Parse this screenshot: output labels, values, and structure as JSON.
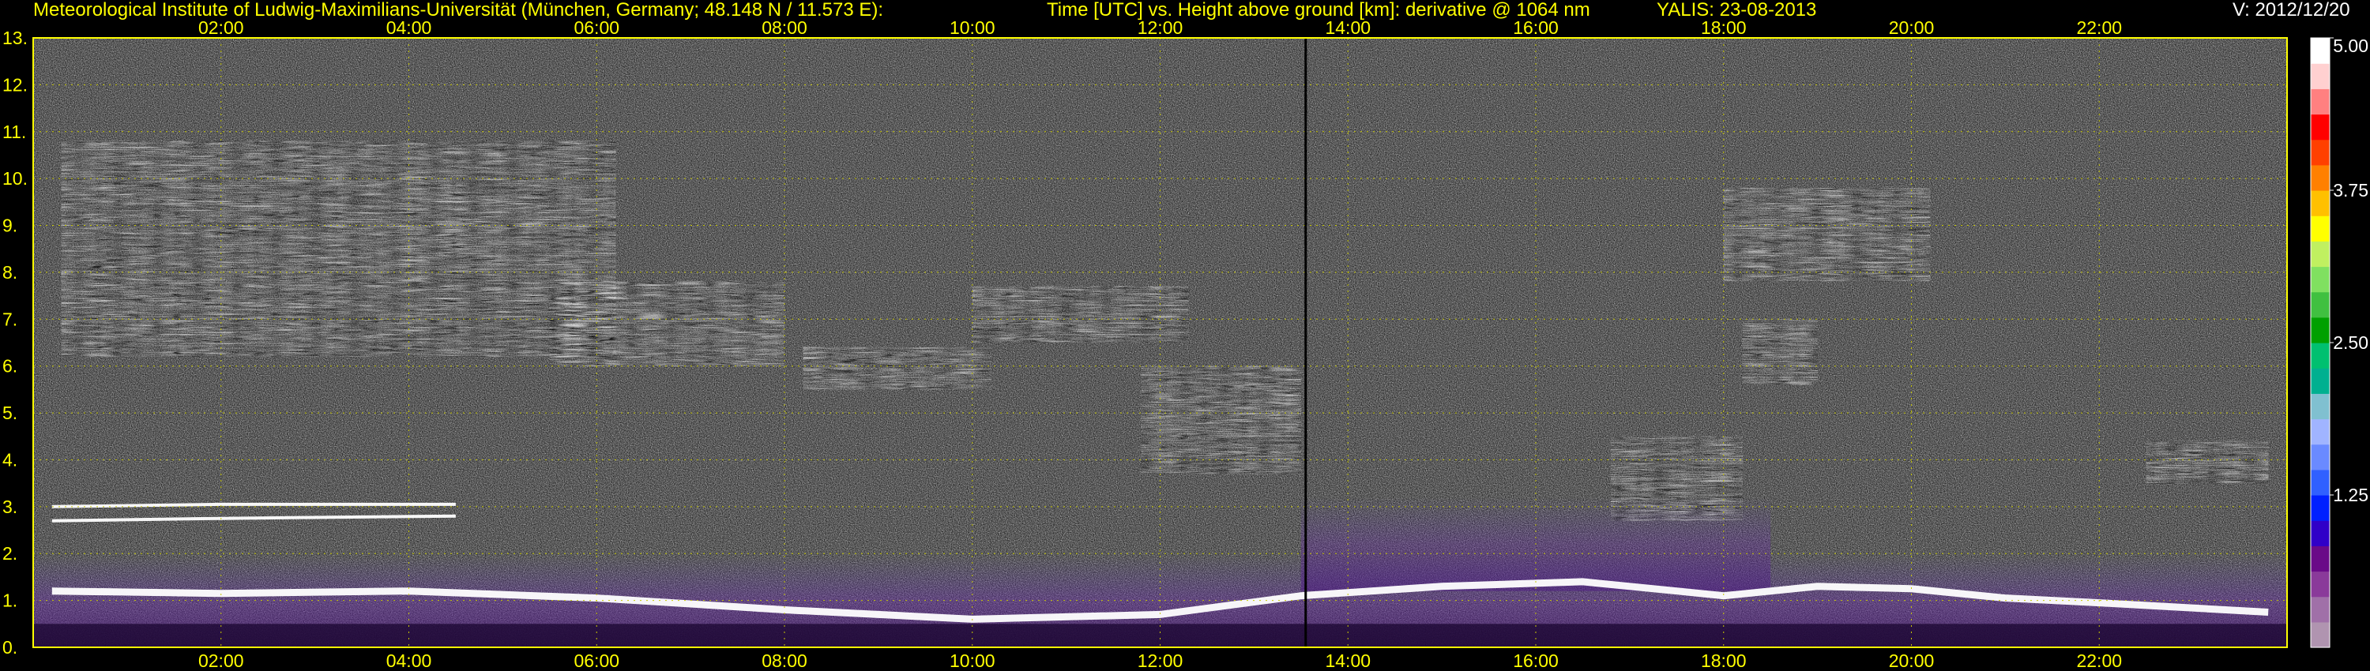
{
  "header": {
    "institute": "Meteorological Institute of Ludwig-Maximilians-Universität (München, Germany; 48.148 N / 11.573 E):",
    "description": "Time [UTC] vs. Height above ground [km]: derivative @ 1064 nm",
    "station_date": "YALIS: 23-08-2013",
    "version": "V: 2012/12/20"
  },
  "chart_data": {
    "type": "heatmap",
    "x_ticks": [
      "02:00",
      "04:00",
      "06:00",
      "08:00",
      "10:00",
      "12:00",
      "14:00",
      "16:00",
      "18:00",
      "20:00",
      "22:00"
    ],
    "x_tick_hours": [
      2,
      4,
      6,
      8,
      10,
      12,
      14,
      16,
      18,
      20,
      22
    ],
    "xlim": [
      0,
      24
    ],
    "y_ticks": [
      "0.",
      "1.",
      "2.",
      "3.",
      "4.",
      "5.",
      "6.",
      "7.",
      "8.",
      "9.",
      "10.",
      "11.",
      "12.",
      "13."
    ],
    "y_tick_values": [
      0,
      1,
      2,
      3,
      4,
      5,
      6,
      7,
      8,
      9,
      10,
      11,
      12,
      13
    ],
    "ylim": [
      0,
      13
    ],
    "grid": true,
    "marker_line_hour": 13.55,
    "colorbar": {
      "ticks": [
        "5.00",
        "3.75",
        "2.50",
        "1.25"
      ],
      "tick_values": [
        5.0,
        3.75,
        2.5,
        1.25
      ],
      "range": [
        0,
        5
      ],
      "colors": [
        "#b094b0",
        "#a070a8",
        "#8a3a9a",
        "#6a0a88",
        "#3000c8",
        "#0020ff",
        "#3060ff",
        "#6a8aff",
        "#a0b4ff",
        "#80c0d0",
        "#00b090",
        "#00c070",
        "#00a000",
        "#40c040",
        "#80e060",
        "#c0f060",
        "#ffff00",
        "#ffc000",
        "#ff8000",
        "#ff4000",
        "#ff0000",
        "#ff8080",
        "#ffd0d0",
        "#ffffff"
      ]
    },
    "features": [
      {
        "kind": "boundary_layer",
        "points": [
          [
            0.2,
            1.2
          ],
          [
            2,
            1.15
          ],
          [
            4,
            1.2
          ],
          [
            6,
            1.05
          ],
          [
            8,
            0.8
          ],
          [
            10,
            0.6
          ],
          [
            12,
            0.7
          ],
          [
            13.5,
            1.1
          ],
          [
            15,
            1.3
          ],
          [
            16.5,
            1.4
          ],
          [
            17.5,
            1.2
          ],
          [
            18,
            1.1
          ],
          [
            19,
            1.3
          ],
          [
            20,
            1.25
          ],
          [
            21,
            1.05
          ],
          [
            22,
            0.95
          ],
          [
            23.8,
            0.75
          ]
        ]
      },
      {
        "kind": "residual_layer",
        "points": [
          [
            0.2,
            2.7
          ],
          [
            2,
            2.75
          ],
          [
            4.5,
            2.8
          ]
        ]
      },
      {
        "kind": "residual_layer",
        "points": [
          [
            0.2,
            3.0
          ],
          [
            2,
            3.05
          ],
          [
            4.5,
            3.05
          ]
        ]
      },
      {
        "kind": "cloud",
        "hours": [
          0.3,
          6.2
        ],
        "km": [
          6.2,
          10.8
        ]
      },
      {
        "kind": "cloud",
        "hours": [
          5.5,
          8.0
        ],
        "km": [
          6.0,
          7.8
        ]
      },
      {
        "kind": "cloud",
        "hours": [
          8.2,
          10.2
        ],
        "km": [
          5.5,
          6.4
        ]
      },
      {
        "kind": "cloud",
        "hours": [
          10.0,
          12.3
        ],
        "km": [
          6.5,
          7.7
        ]
      },
      {
        "kind": "cloud",
        "hours": [
          11.8,
          13.5
        ],
        "km": [
          3.7,
          6.0
        ]
      },
      {
        "kind": "cloud",
        "hours": [
          16.8,
          18.2
        ],
        "km": [
          2.7,
          4.5
        ]
      },
      {
        "kind": "cloud",
        "hours": [
          18.0,
          20.2
        ],
        "km": [
          7.8,
          9.8
        ]
      },
      {
        "kind": "cloud",
        "hours": [
          18.2,
          19.0
        ],
        "km": [
          5.6,
          7.0
        ]
      },
      {
        "kind": "cloud",
        "hours": [
          22.5,
          23.8
        ],
        "km": [
          3.5,
          4.4
        ]
      }
    ]
  }
}
